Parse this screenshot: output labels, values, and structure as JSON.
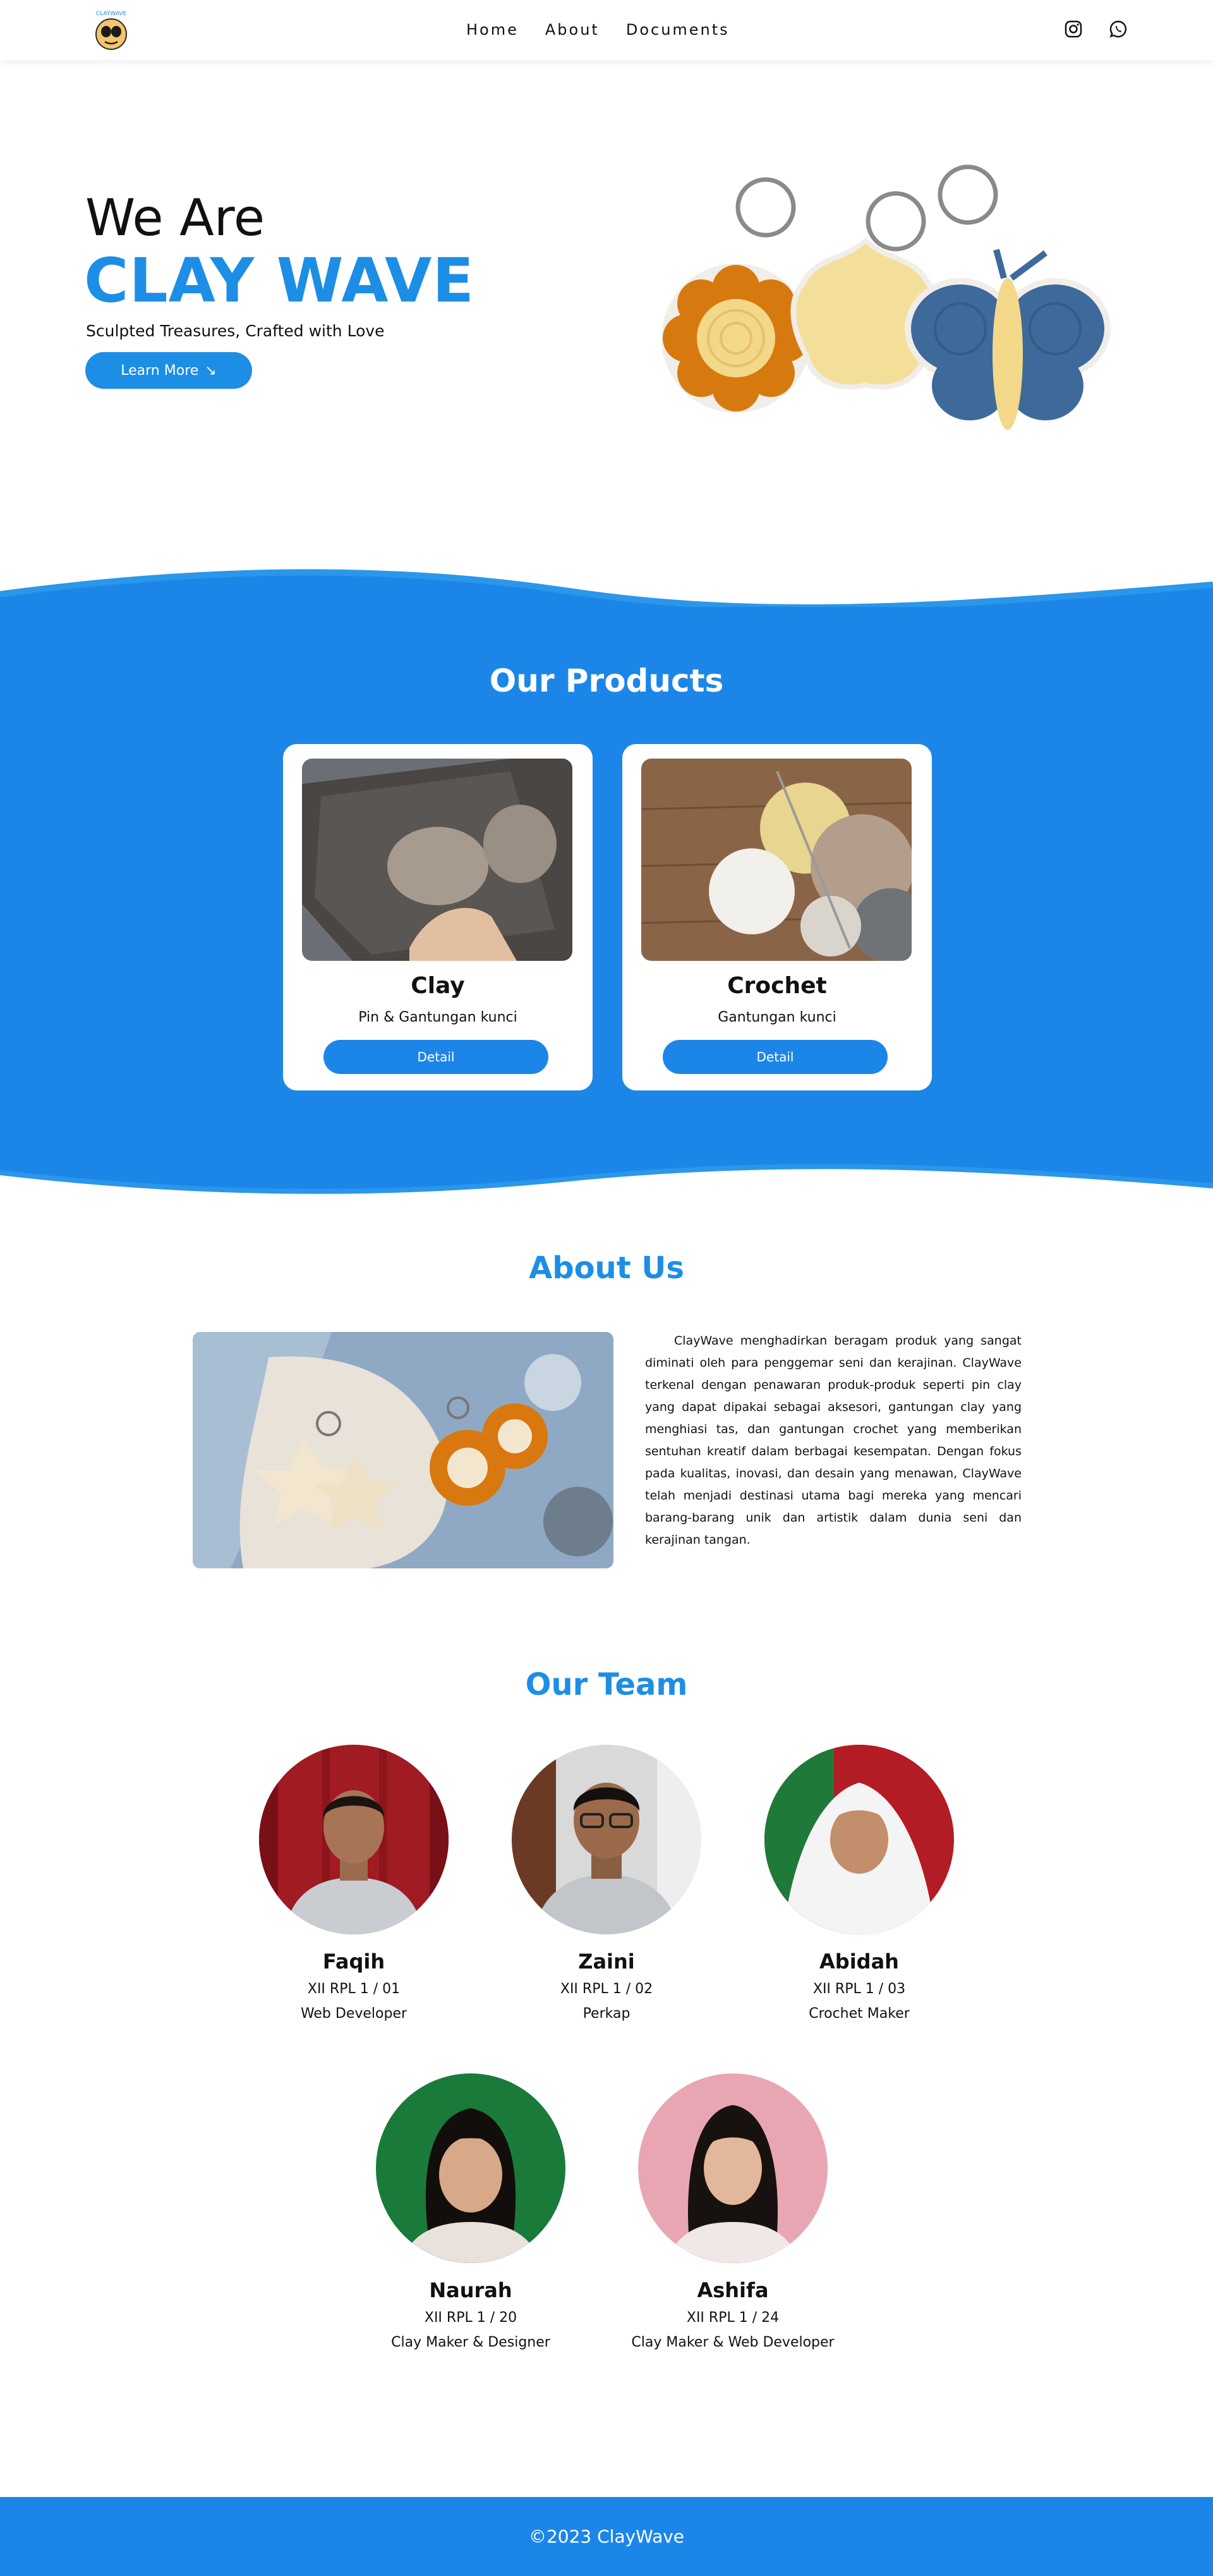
{
  "nav": {
    "brand": "CLAYWAVE",
    "links": [
      "Home",
      "About",
      "Documents"
    ],
    "social": [
      "instagram-icon",
      "whatsapp-icon"
    ]
  },
  "hero": {
    "line1": "We Are",
    "line2": "CLAY WAVE",
    "tagline": "Sculpted Treasures, Crafted with Love",
    "button": "Learn More",
    "button_icon": "↘"
  },
  "products": {
    "title": "Our Products",
    "items": [
      {
        "name": "Clay",
        "desc": "Pin & Gantungan kunci",
        "button": "Detail"
      },
      {
        "name": "Crochet",
        "desc": "Gantungan kunci",
        "button": "Detail"
      }
    ]
  },
  "about": {
    "title": "About Us",
    "text": "ClayWave menghadirkan beragam produk yang sangat diminati oleh para penggemar seni dan kerajinan. ClayWave terkenal dengan penawaran produk-produk seperti pin clay yang dapat dipakai sebagai aksesori, gantungan clay yang menghiasi tas, dan gantungan crochet yang memberikan sentuhan kreatif dalam berbagai kesempatan. Dengan fokus pada kualitas, inovasi, dan desain yang menawan, ClayWave telah menjadi destinasi utama bagi mereka yang mencari barang-barang unik dan artistik dalam dunia seni dan kerajinan tangan."
  },
  "team": {
    "title": "Our Team",
    "members": [
      {
        "name": "Faqih",
        "class": "XII RPL 1 / 01",
        "role": "Web Developer"
      },
      {
        "name": "Zaini",
        "class": "XII RPL 1 / 02",
        "role": "Perkap"
      },
      {
        "name": "Abidah",
        "class": "XII RPL 1 / 03",
        "role": "Crochet Maker"
      },
      {
        "name": "Naurah",
        "class": "XII RPL 1 / 20",
        "role": "Clay Maker & Designer"
      },
      {
        "name": "Ashifa",
        "class": "XII RPL 1 / 24",
        "role": "Clay Maker & Web Developer"
      }
    ]
  },
  "footer": {
    "text": "©2023 ClayWave"
  },
  "colors": {
    "accent": "#1c8ee6",
    "section_blue": "#1c86e8"
  }
}
